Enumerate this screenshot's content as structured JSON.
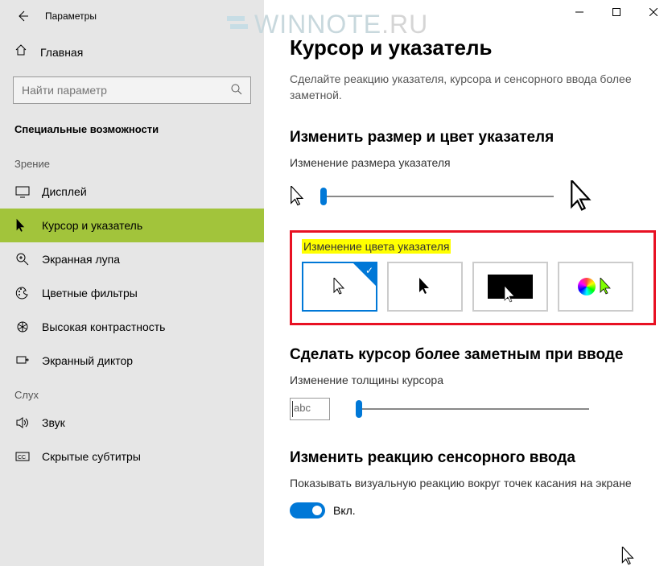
{
  "titlebar": {
    "title": "Параметры"
  },
  "sidebar": {
    "home_label": "Главная",
    "search_placeholder": "Найти параметр",
    "section_title": "Специальные возможности",
    "group_vision": "Зрение",
    "group_hearing": "Слух",
    "items_vision": [
      {
        "label": "Дисплей",
        "icon": "display-icon"
      },
      {
        "label": "Курсор и указатель",
        "icon": "cursor-icon",
        "selected": true
      },
      {
        "label": "Экранная лупа",
        "icon": "magnifier-icon"
      },
      {
        "label": "Цветные фильтры",
        "icon": "palette-icon"
      },
      {
        "label": "Высокая контрастность",
        "icon": "contrast-icon"
      },
      {
        "label": "Экранный диктор",
        "icon": "narrator-icon"
      }
    ],
    "items_hearing": [
      {
        "label": "Звук",
        "icon": "audio-icon"
      },
      {
        "label": "Скрытые субтитры",
        "icon": "cc-icon"
      }
    ]
  },
  "watermark": {
    "text1": "WINNOTE",
    "text2": ".RU"
  },
  "main": {
    "page_title": "Курсор и указатель",
    "description": "Сделайте реакцию указателя, курсора и сенсорного ввода более заметной.",
    "size_heading": "Изменить размер и цвет указателя",
    "size_label": "Изменение размера указателя",
    "color_label": "Изменение цвета указателя",
    "cursor_heading": "Сделать курсор более заметным при вводе",
    "thickness_label": "Изменение толщины курсора",
    "abc_text": "abc",
    "touch_heading": "Изменить реакцию сенсорного ввода",
    "touch_label": "Показывать визуальную реакцию вокруг точек касания на экране",
    "toggle_on_label": "Вкл.",
    "toggle_on": true
  },
  "colors": {
    "accent": "#0078d7",
    "sidebar_selected": "#a2c43b",
    "highlight_border": "#e81123"
  }
}
